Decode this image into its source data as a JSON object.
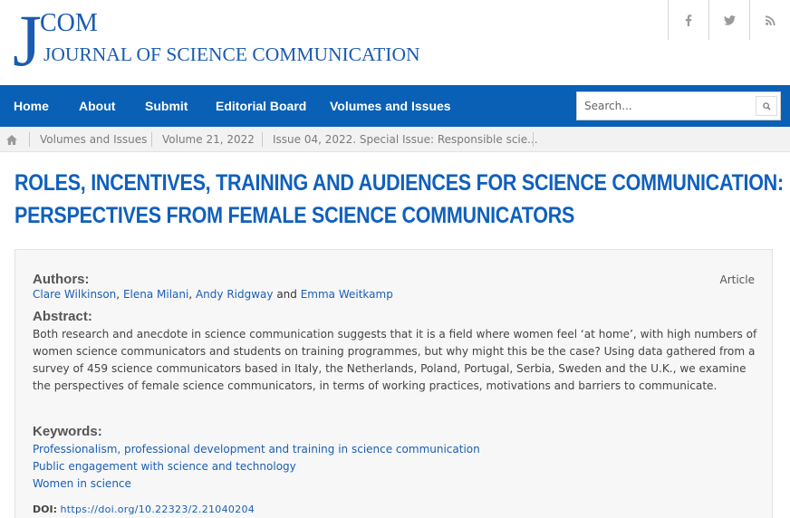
{
  "header": {
    "logo_j": "J",
    "logo_com": "COM",
    "logo_subtitle": "JOURNAL OF SCIENCE COMMUNICATION",
    "social": [
      "f",
      "t",
      "rss"
    ],
    "social_icons": [
      "facebook-icon",
      "twitter-icon",
      "rss-icon"
    ]
  },
  "nav": {
    "items": [
      "Home",
      "About",
      "Submit",
      "Editorial Board",
      "Volumes and Issues"
    ],
    "search_placeholder": "Search..."
  },
  "breadcrumb": {
    "items": [
      "Volumes and Issues",
      "Volume 21, 2022",
      "Issue 04, 2022. Special Issue: Responsible scie..."
    ]
  },
  "article": {
    "title_line1": "ROLES, INCENTIVES, TRAINING AND AUDIENCES FOR SCIENCE COMMUNICATION:",
    "title_line2": "PERSPECTIVES FROM FEMALE SCIENCE COMMUNICATORS",
    "type": "Article",
    "authors_label": "Authors:",
    "authors": [
      "Clare Wilkinson",
      "Elena Milani",
      "Andy Ridgway",
      "Emma Weitkamp"
    ],
    "authors_sep": ", ",
    "authors_and": " and ",
    "abstract_label": "Abstract:",
    "abstract": "Both research and anecdote in science communication suggests that it is a field where women feel ‘at home’, with high numbers of women science communicators and students on training programmes, but why might this be the case? Using data gathered from a survey of 459 science communicators based in Italy, the Netherlands, Poland, Portugal, Serbia, Sweden and the U.K., we examine the perspectives of female science communicators, in terms of working practices, motivations and barriers to communicate.",
    "keywords_label": "Keywords:",
    "keywords": [
      "Professionalism, professional development and training in science communication",
      "Public engagement with science and technology",
      "Women in science"
    ],
    "doi_label": "DOI:",
    "doi": "https://doi.org/10.22323/2.21040204"
  },
  "colors": {
    "nav_bg": "#0960b5",
    "title": "#1060bd",
    "link": "#1a5fb4",
    "logo": "#1a5bb0"
  }
}
